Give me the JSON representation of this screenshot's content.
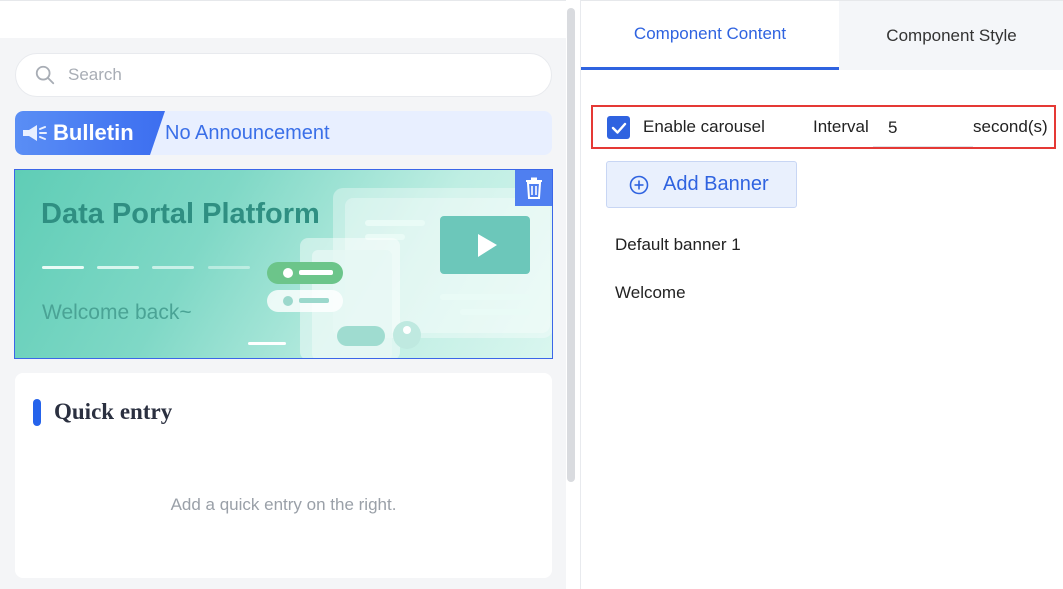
{
  "preview": {
    "search_placeholder": "Search",
    "bulletin_label": "Bulletin",
    "bulletin_text": "No Announcement",
    "banner_title": "Data Portal Platform",
    "banner_subtitle": "Welcome back~",
    "quick_entry_title": "Quick entry",
    "quick_entry_empty": "Add a quick entry on the right."
  },
  "panel": {
    "tabs": [
      {
        "label": "Component Content",
        "active": true
      },
      {
        "label": "Component Style",
        "active": false
      }
    ],
    "carousel": {
      "enable_label": "Enable carousel",
      "enabled": true,
      "interval_label": "Interval",
      "interval_value": "5",
      "unit_label": "second(s)"
    },
    "add_banner_label": "Add Banner",
    "banners": [
      "Default banner 1",
      "Welcome"
    ]
  },
  "colors": {
    "accent": "#2f63e0",
    "highlight_border": "#e53935",
    "banner_teal": "#5fcdb6"
  }
}
